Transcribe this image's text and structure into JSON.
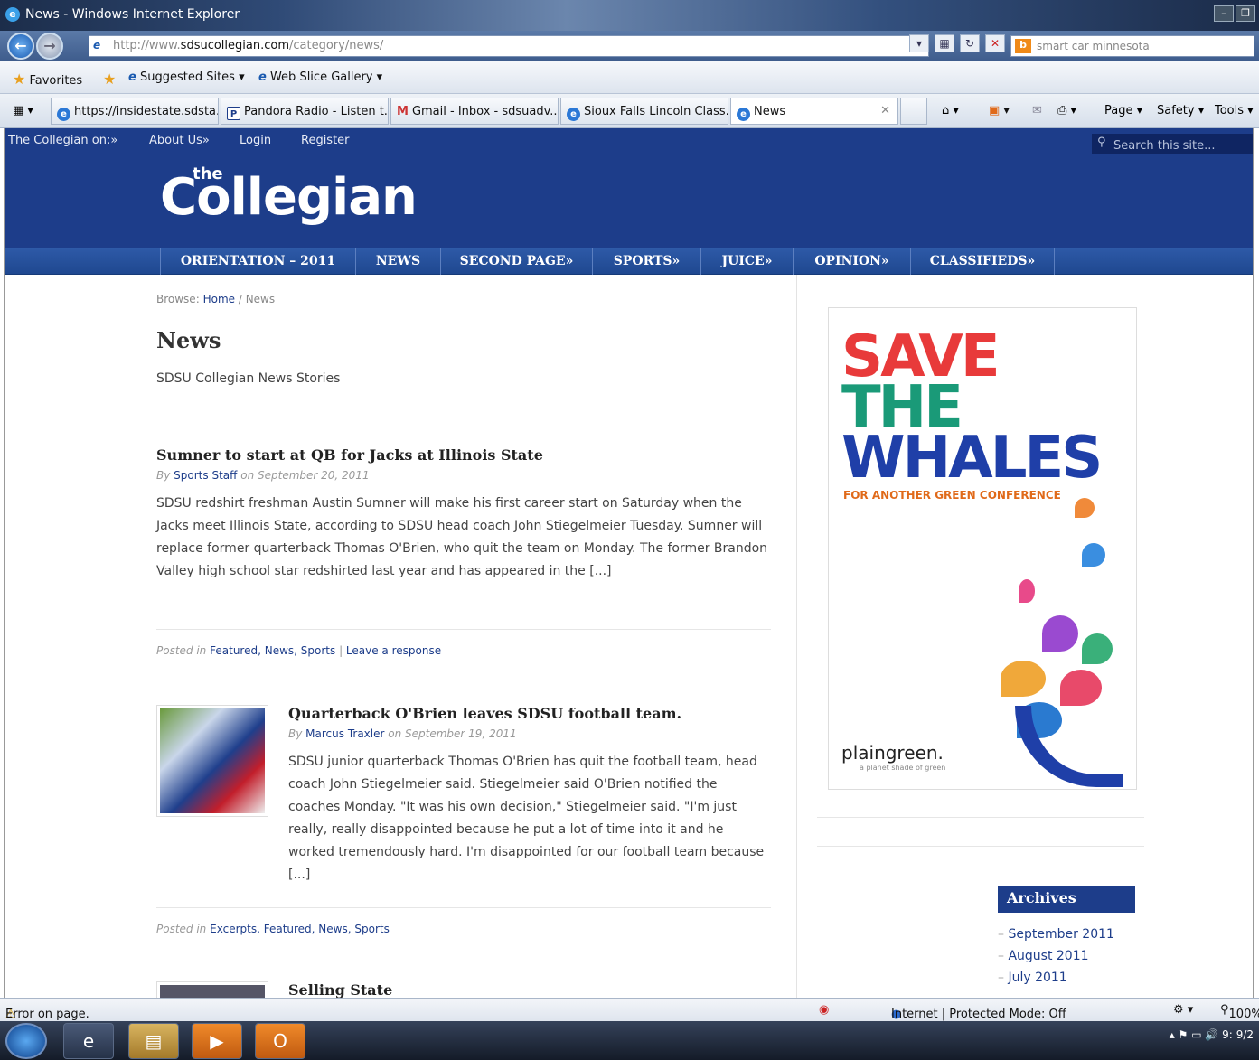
{
  "window": {
    "title": "News - Windows Internet Explorer"
  },
  "address": {
    "url_prefix": "http://www.",
    "url_domain": "sdsucollegian.com",
    "url_path": "/category/news/",
    "search_text": "smart car minnesota"
  },
  "favorites_bar": {
    "favorites": "Favorites",
    "suggested": "Suggested Sites ▾",
    "webslice": "Web Slice Gallery ▾"
  },
  "tabs": [
    {
      "label": "https://insidestate.sdsta..."
    },
    {
      "label": "Pandora Radio - Listen t..."
    },
    {
      "label": "Gmail - Inbox - sdsuadv..."
    },
    {
      "label": "Sioux Falls Lincoln Class..."
    },
    {
      "label": "News"
    }
  ],
  "commands": {
    "page": "Page ▾",
    "safety": "Safety ▾",
    "tools": "Tools ▾"
  },
  "site": {
    "topnav": {
      "collegian_on": "The Collegian on:»",
      "about": "About Us»",
      "login": "Login",
      "register": "Register",
      "search_placeholder": "Search this site..."
    },
    "logo": {
      "the": "the",
      "name": "Collegian"
    },
    "mainnav": [
      "ORIENTATION – 2011",
      "NEWS",
      "SECOND PAGE»",
      "SPORTS»",
      "JUICE»",
      "OPINION»",
      "CLASSIFIEDS»"
    ],
    "breadcrumb": {
      "browse": "Browse:",
      "home": "Home",
      "sep": " / ",
      "current": "News"
    },
    "page_title": "News",
    "page_desc": "SDSU Collegian News Stories",
    "posts": [
      {
        "title": "Sumner to start at QB for Jacks at Illinois State",
        "by": "By",
        "author": "Sports Staff",
        "on": "on September 20, 2011",
        "excerpt": "SDSU redshirt freshman Austin Sumner will make his first career start on Saturday when the Jacks meet Illinois State, according to SDSU head coach John Stiegelmeier Tuesday. Sumner will replace former quarterback Thomas O'Brien, who quit the team on Monday. The former Brandon Valley high school star redshirted last year and has appeared in the [...]",
        "posted_in": "Posted in",
        "cats": "Featured, News, Sports",
        "sep": " | ",
        "response": "Leave a response"
      },
      {
        "title": "Quarterback O'Brien leaves SDSU football team.",
        "by": "By",
        "author": "Marcus Traxler",
        "on": "on September 19, 2011",
        "excerpt": "SDSU junior quarterback Thomas O'Brien has quit the football team, head coach John Stiegelmeier said. Stiegelmeier said O'Brien notified the coaches Monday. \"It was his own decision,\" Stiegelmeier said. \"I'm just really, really disappointed because he put a lot of time into it and he worked tremendously hard. I'm disappointed for our football team because [...]",
        "posted_in": "Posted in",
        "cats": "Excerpts, Featured, News, Sports"
      },
      {
        "title": "Selling State"
      }
    ],
    "ad": {
      "line1": "SAVE",
      "line2": "THE",
      "line3": "WHALES",
      "tagline": "FOR ANOTHER GREEN CONFERENCE",
      "brand": "plaingreen.",
      "brand_sub": "a planet shade of green"
    },
    "archives": {
      "heading": "Archives",
      "items": [
        "September 2011",
        "August 2011",
        "July 2011"
      ]
    }
  },
  "status": {
    "error": "Error on page.",
    "zone": "Internet | Protected Mode: Off",
    "zoom": "100%",
    "clock": "9:",
    "date": "9/2"
  }
}
